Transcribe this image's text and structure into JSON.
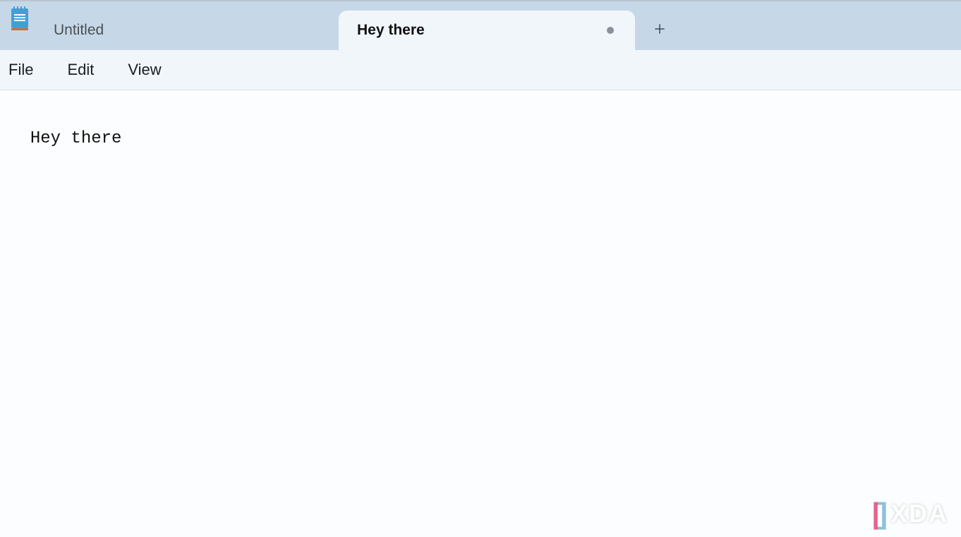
{
  "tabs": [
    {
      "label": "Untitled",
      "active": false,
      "unsaved": false
    },
    {
      "label": "Hey there",
      "active": true,
      "unsaved": true
    }
  ],
  "menu": {
    "file": "File",
    "edit": "Edit",
    "view": "View"
  },
  "editor": {
    "content": "Hey there"
  },
  "watermark": {
    "text": "XDA"
  }
}
